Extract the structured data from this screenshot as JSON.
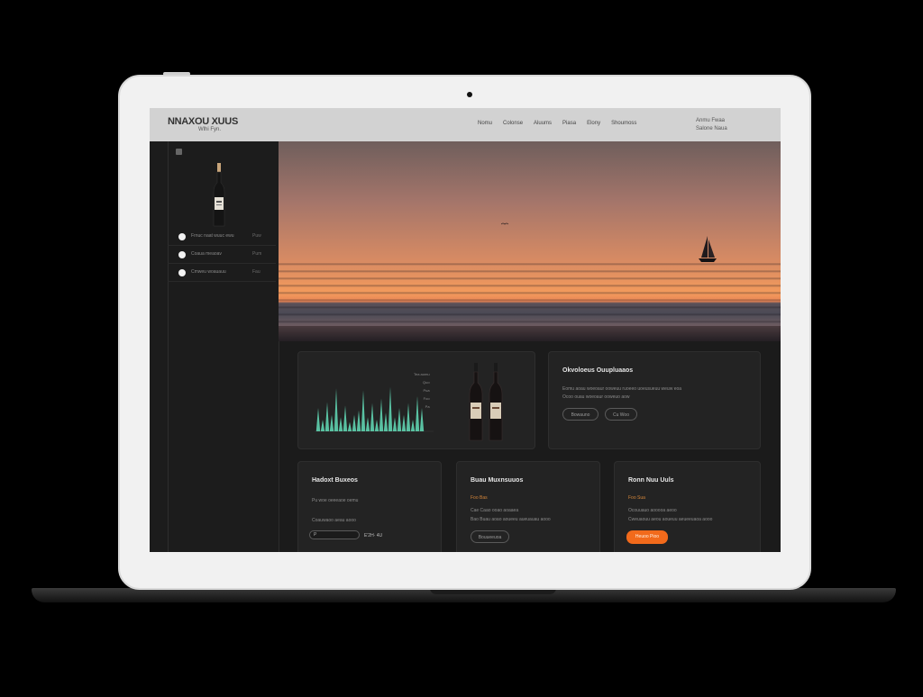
{
  "brand": {
    "title": "NNAXOU XUUS",
    "subtitle": "Wlhi Fyn."
  },
  "nav": {
    "items": [
      "Nomu",
      "Colonse",
      "Aluums",
      "Piasa",
      "Elony",
      "Shoumoss"
    ]
  },
  "account": {
    "line1": "Anmu Fwaa",
    "line2": "Salone Naua"
  },
  "sidebar": {
    "items": [
      {
        "label": "Frnuc naat wuuc ewu",
        "meta": "Puw"
      },
      {
        "label": "Coaua meaoav",
        "meta": "Pum"
      },
      {
        "label": "Cmweu woauauu",
        "meta": "Fau"
      }
    ]
  },
  "chart_card": {
    "legend": [
      "Tea aomu",
      "Quo",
      "Pua",
      "Foo",
      "Pa"
    ],
    "chart_data": {
      "type": "bar",
      "series": [
        {
          "values": [
            0.5,
            0.25,
            0.62,
            0.35,
            0.92,
            0.3,
            0.55,
            0.2,
            0.35,
            0.45,
            0.88,
            0.3,
            0.6,
            0.25,
            0.7,
            0.4,
            0.95,
            0.3,
            0.5,
            0.35,
            0.6,
            0.25,
            0.75,
            0.5
          ]
        }
      ]
    }
  },
  "info_card": {
    "title": "Okvoloeus Ouupluaaos",
    "lines": [
      "Eomu aoau woeoaur ooweuu ruoeeo uoeusueuu weuw eoa",
      "Ocoo ouau woeoaur ooweuo aow"
    ],
    "btn1": "Bowauno",
    "btn2": "Cu Woo"
  },
  "card_a": {
    "title": "Hadoxt Buxeos",
    "line1": "Pu woe oeeeaoe oemu",
    "line2": "Coauwaoo aeau aooo",
    "input_value": "P",
    "suffix": "E'2H· 4U"
  },
  "card_b": {
    "title": "Buau Muxnsuuos",
    "accent": "Foo Bas",
    "line1": "Cae Caao ooao aoaaea",
    "line2": "Bao Buau aoao aoueeu aueuauau aooo",
    "button": "Bouueeuoa"
  },
  "card_c": {
    "title": "Ronn Nuu Uuls",
    "accent": "Foo Sua",
    "line1": "Ocouuauo aooooa aeoo",
    "line2": "Cweuaouu aeou aoueuu aeueeuaoa aooo",
    "button": "Heuoo Pioo"
  },
  "colors": {
    "accent": "#f26a1b",
    "chart": "#5fd3b0",
    "brand_accent": "#d4863a"
  }
}
